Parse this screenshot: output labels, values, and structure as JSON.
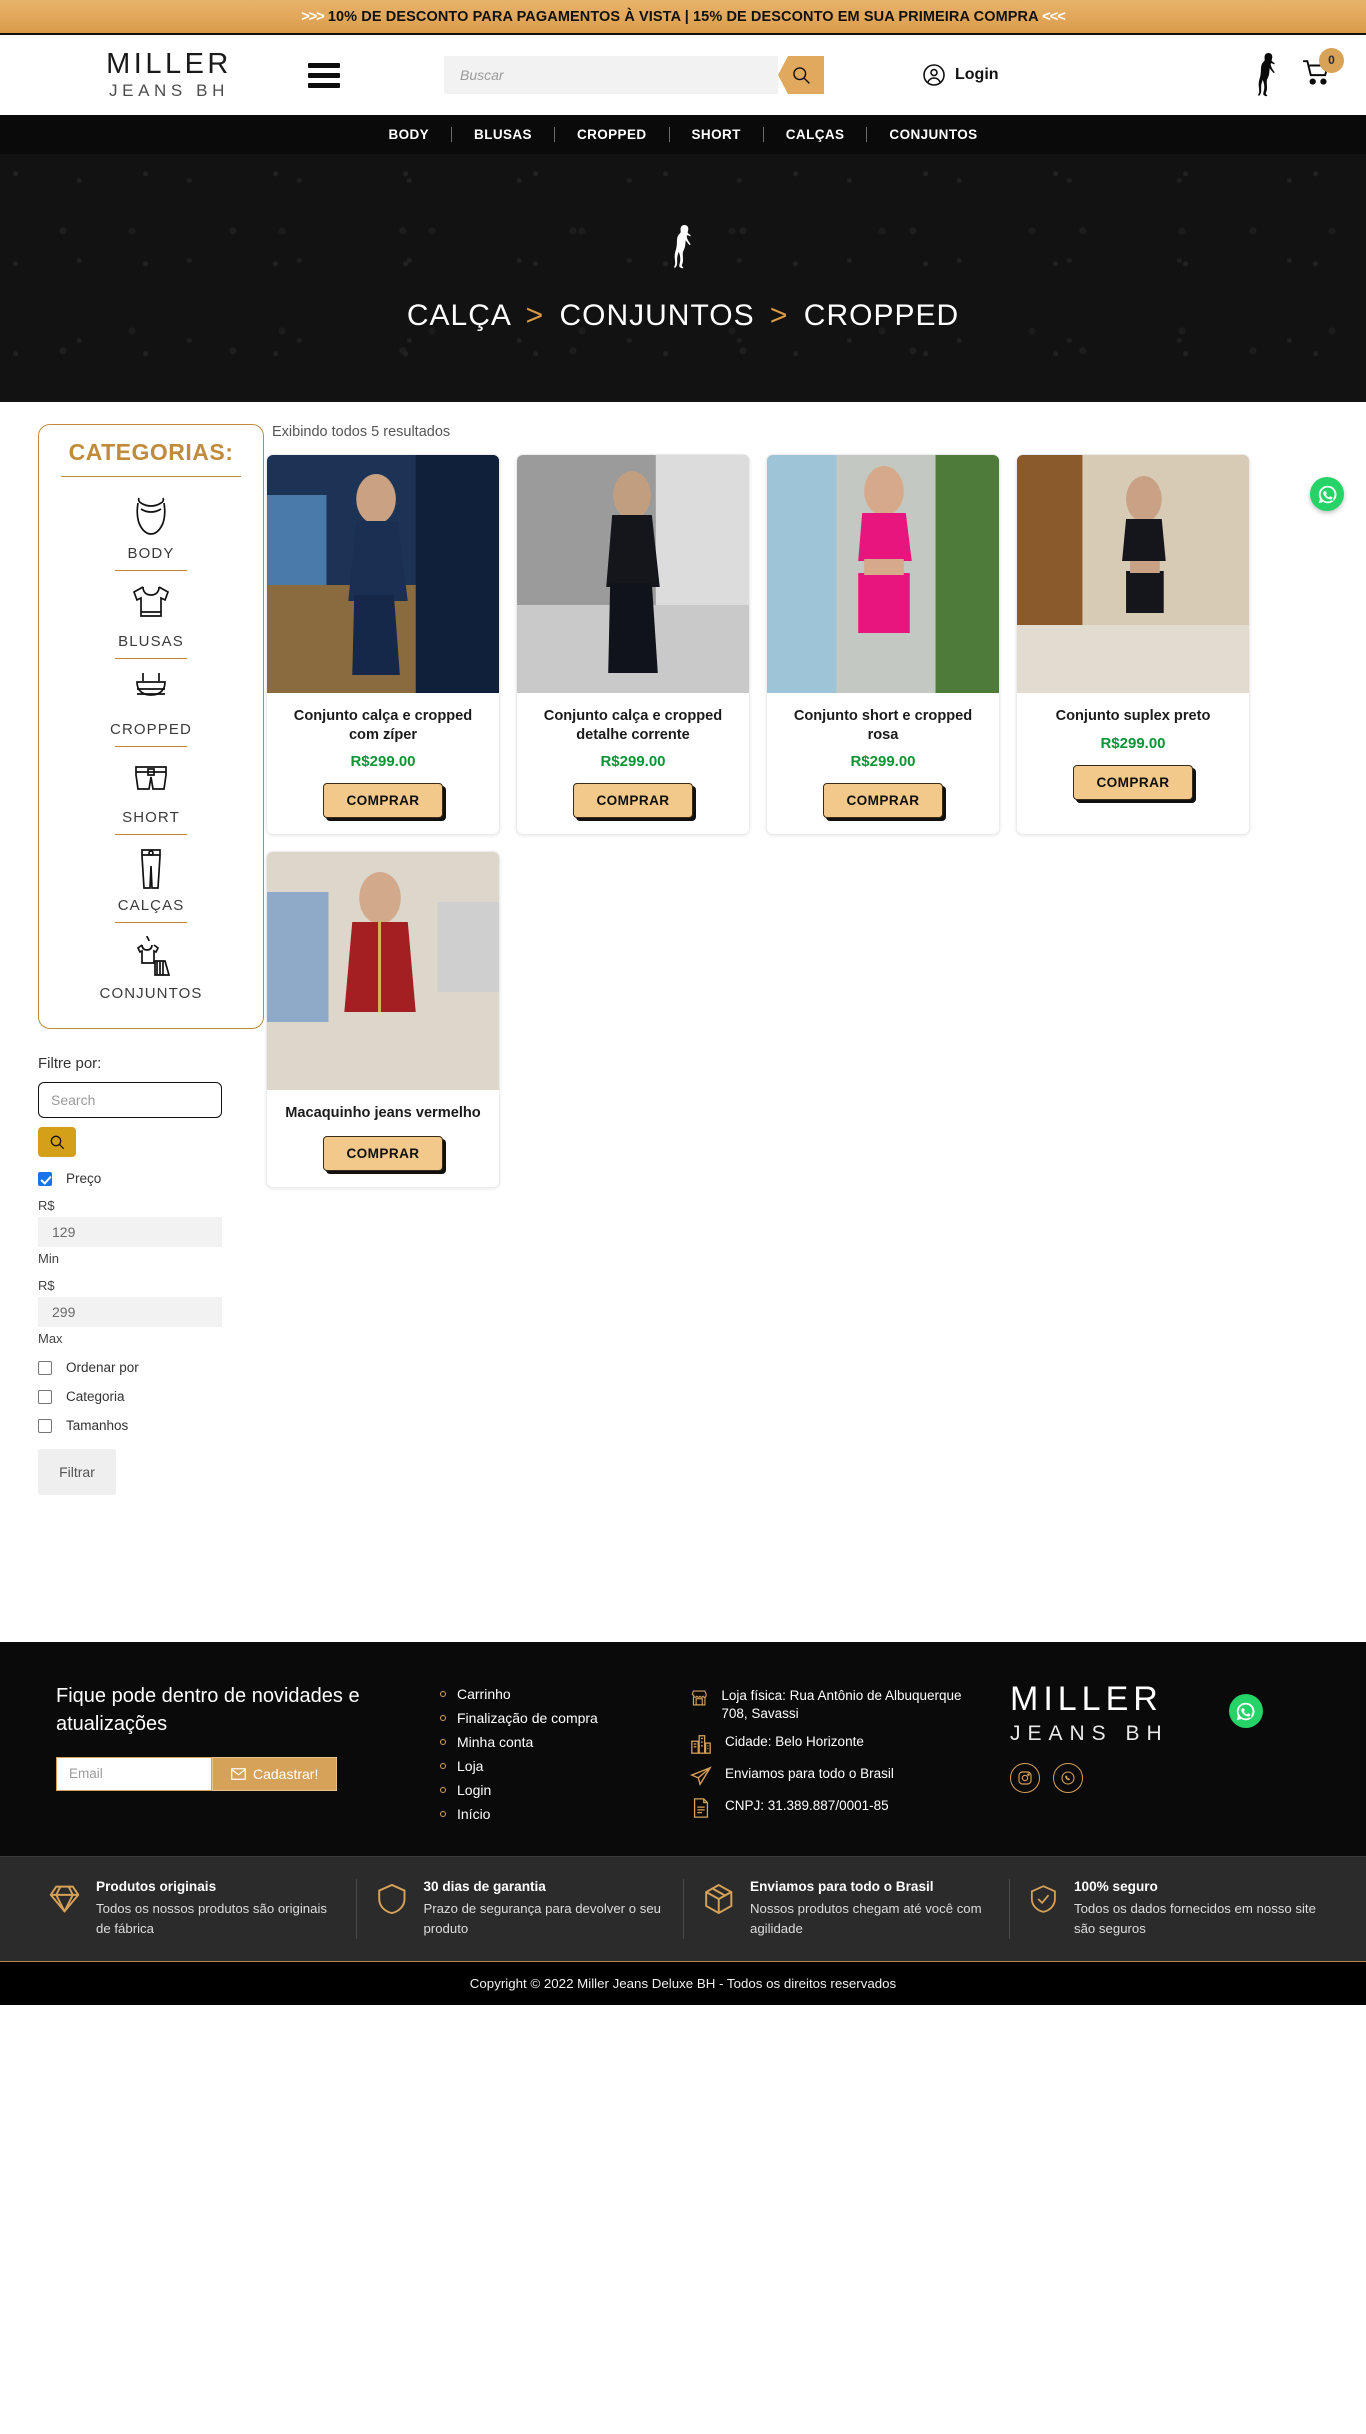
{
  "promo": {
    "left_arrows": ">>>",
    "text": "10% DE DESCONTO PARA PAGAMENTOS À VISTA | 15% DE DESCONTO EM SUA PRIMEIRA COMPRA",
    "right_arrows": "<<<"
  },
  "header": {
    "logo_main": "MILLER",
    "logo_sub": "JEANS BH",
    "search_placeholder": "Buscar",
    "search_value": "",
    "account_label": "Login",
    "cart_count": "0"
  },
  "nav": {
    "items": [
      {
        "label": "BODY"
      },
      {
        "label": "BLUSAS"
      },
      {
        "label": "CROPPED"
      },
      {
        "label": "SHORT"
      },
      {
        "label": "CALÇAS"
      },
      {
        "label": "CONJUNTOS"
      }
    ]
  },
  "hero": {
    "crumb1": "CALÇA",
    "sep1": ">",
    "crumb2": "CONJUNTOS",
    "sep2": ">",
    "crumb3": "CROPPED"
  },
  "sidebar": {
    "title": "CATEGORIAS:",
    "items": [
      {
        "label": "BODY",
        "icon": "bodysuit-icon"
      },
      {
        "label": "BLUSAS",
        "icon": "tshirt-icon"
      },
      {
        "label": "CROPPED",
        "icon": "bra-top-icon"
      },
      {
        "label": "SHORT",
        "icon": "shorts-icon"
      },
      {
        "label": "CALÇAS",
        "icon": "pants-icon"
      },
      {
        "label": "CONJUNTOS",
        "icon": "outfit-set-icon"
      }
    ]
  },
  "filters": {
    "title": "Filtre por:",
    "search_placeholder": "Search",
    "search_value": "",
    "price_label": "Preço",
    "price_checked": true,
    "min_currency": "R$",
    "min_value": "129",
    "min_caption": "Min",
    "max_currency": "R$",
    "max_value": "299",
    "max_caption": "Max",
    "options": [
      {
        "label": "Ordenar por",
        "checked": false
      },
      {
        "label": "Categoria",
        "checked": false
      },
      {
        "label": "Tamanhos",
        "checked": false
      }
    ],
    "submit_label": "Filtrar"
  },
  "products": {
    "result_count": "Exibindo todos 5 resultados",
    "buy_label": "COMPRAR",
    "items": [
      {
        "title": "Conjunto calça e cropped com zíper",
        "price": "R$299.00",
        "img_top": "#2d4668",
        "img_bottom": "#8a6b3f"
      },
      {
        "title": "Conjunto calça e cropped detalhe corrente",
        "price": "R$299.00",
        "img_top": "#9b9b9b",
        "img_bottom": "#d6d6d6"
      },
      {
        "title": "Conjunto short e cropped rosa",
        "price": "R$299.00",
        "img_top": "#8fb6c9",
        "img_bottom": "#4e7a3a"
      },
      {
        "title": "Conjunto suplex preto",
        "price": "R$299.00",
        "img_top": "#8a5a2b",
        "img_bottom": "#c8b49a"
      },
      {
        "title": "Macaquinho jeans vermelho",
        "price": "",
        "img_top": "#c9c2b8",
        "img_bottom": "#9c4a3a"
      }
    ]
  },
  "whatsapp_float": {
    "icon": "whatsapp-icon"
  },
  "footer": {
    "newsletter_title": "Fique pode dentro de novidades e atualizações",
    "email_placeholder": "Email",
    "email_value": "",
    "signup_label": "Cadastrar!",
    "links": [
      {
        "label": "Carrinho"
      },
      {
        "label": "Finalização de compra"
      },
      {
        "label": "Minha conta"
      },
      {
        "label": "Loja"
      },
      {
        "label": "Login"
      },
      {
        "label": "Início"
      }
    ],
    "info": [
      {
        "icon": "store-icon",
        "text": "Loja física: Rua Antônio de Albuquerque 708, Savassi"
      },
      {
        "icon": "city-icon",
        "text": "Cidade: Belo Horizonte"
      },
      {
        "icon": "paper-plane-icon",
        "text": "Enviamos para todo o Brasil"
      },
      {
        "icon": "document-icon",
        "text": "CNPJ: 31.389.887/0001-85"
      }
    ],
    "brand_main": "MILLER",
    "brand_sub": "JEANS BH",
    "socials": [
      {
        "icon": "instagram-icon"
      },
      {
        "icon": "whatsapp-icon"
      }
    ]
  },
  "trust": [
    {
      "icon": "diamond-icon",
      "title": "Produtos originais",
      "desc": "Todos os nossos produtos são originais de fábrica"
    },
    {
      "icon": "shield-icon",
      "title": "30 dias de garantia",
      "desc": "Prazo de segurança para devolver o seu produto"
    },
    {
      "icon": "box-icon",
      "title": "Enviamos para todo o Brasil",
      "desc": "Nossos produtos chegam até você com agilidade"
    },
    {
      "icon": "shield-check-icon",
      "title": "100% seguro",
      "desc": "Todos os dados fornecidos em nosso site são seguros"
    }
  ],
  "copyright": "Copyright © 2022 Miller Jeans Deluxe BH - Todos os direitos reservados",
  "colors": {
    "gold": "#d6a159",
    "gold_dark": "#c08c3c",
    "price_green": "#0d9435",
    "whatsapp": "#25d366",
    "dark": "#0a0a0a"
  }
}
